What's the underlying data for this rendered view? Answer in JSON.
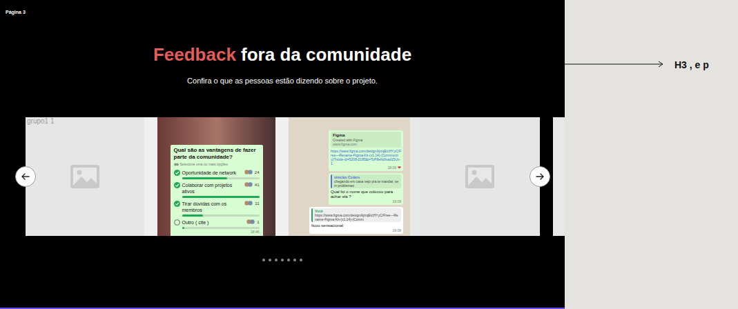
{
  "frame": {
    "label": "Página 3"
  },
  "title": {
    "highlight": "Feedback",
    "rest": " fora da comunidade"
  },
  "subtitle": "Confira o que as pessoas estão dizendo sobre o projeto.",
  "carousel": {
    "cards": [
      {
        "kind": "placeholder",
        "label": "grupo1 1"
      },
      {
        "kind": "poll",
        "question": "Qual são as vantagens de fazer parte da comunidade?",
        "hint": "Selecione uma ou mais opções",
        "options": [
          {
            "label": "Oportunidade de network",
            "count": "24",
            "checked": true,
            "level": 0.585
          },
          {
            "label": "Colaborar com projetos ativos",
            "count": "41",
            "checked": true,
            "level": 1
          },
          {
            "label": "Tirar dúvidas com os membros",
            "count": "11",
            "checked": true,
            "level": 0.27
          },
          {
            "label": "Outro ( cite )",
            "count": "1",
            "checked": false,
            "level": 0.03
          }
        ],
        "time": "18:46"
      },
      {
        "kind": "chat",
        "messages": [
          {
            "kind": "link",
            "outgoing": true,
            "preview_title": "Figma",
            "preview_subtitle": "Created with Figma",
            "preview_domain": "www.figma.com",
            "text": "https://www.figma.com/design/kjrrqEtcHYyC/Free—Rename-Figma-Kit-(v1.14)-(Community)?node-id=5208-2185&t=TcP8eNdIvad15Ux-1",
            "time": "18:09",
            "reaction": "❤"
          },
          {
            "kind": "reply",
            "outgoing": true,
            "quote_author": "vinicius Coders",
            "quote_text": "chegando em casa vejo pra te mandar, sem problemas",
            "text": "Qual foi o nome que colocou para achar ela ?",
            "time": "19:09"
          },
          {
            "kind": "reply",
            "outgoing": false,
            "quote_author": "Você",
            "quote_text": "https://www.figma.com/design/kjrrqEtcHYyC/Free—Rename-Figma-Kit-(v1.14)-(Comm",
            "text": "ficou sensacional",
            "time": "19:08"
          }
        ]
      },
      {
        "kind": "placeholder",
        "label": ""
      }
    ],
    "dots": [
      {
        "selected": false
      },
      {
        "selected": false
      },
      {
        "selected": false
      },
      {
        "selected": false
      },
      {
        "selected": false
      },
      {
        "selected": false
      },
      {
        "selected": false
      }
    ]
  },
  "annotation": "H3 , e p"
}
